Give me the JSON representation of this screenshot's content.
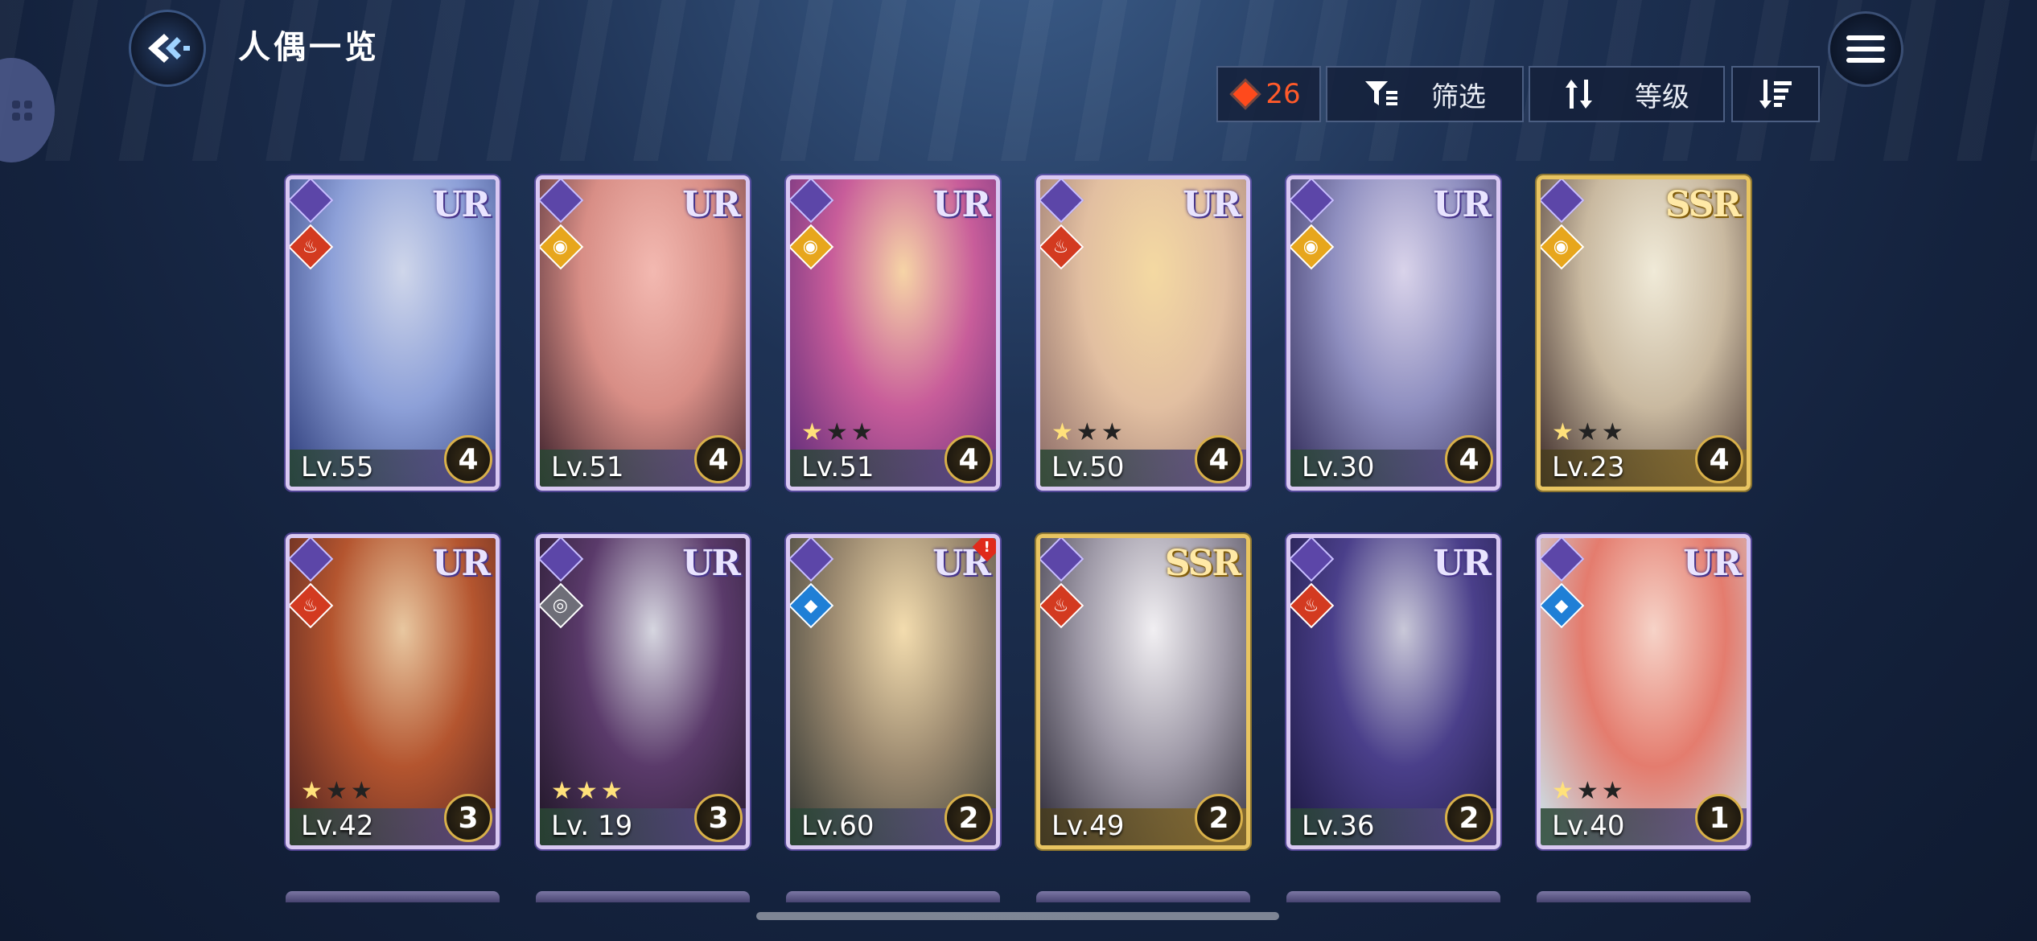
{
  "header": {
    "title": "人偶一览",
    "currency_value": "26",
    "filter_label": "筛选",
    "sort_label": "等级"
  },
  "cards": [
    {
      "rarity": "UR",
      "element": "fire",
      "level": "Lv.55",
      "stars": 0,
      "rank": "4",
      "art": [
        "#cfd6ea",
        "#8da0d8",
        "#2b3a78"
      ]
    },
    {
      "rarity": "UR",
      "element": "light",
      "level": "Lv.51",
      "stars": 0,
      "rank": "4",
      "art": [
        "#f3b9b1",
        "#d88e86",
        "#3a1f2a"
      ]
    },
    {
      "rarity": "UR",
      "element": "light",
      "level": "Lv.51",
      "stars": 1,
      "rank": "4",
      "art": [
        "#f6d4a6",
        "#c85d9a",
        "#5b2a78"
      ]
    },
    {
      "rarity": "UR",
      "element": "fire",
      "level": "Lv.50",
      "stars": 1,
      "rank": "4",
      "art": [
        "#f4d9a2",
        "#e2bfa1",
        "#8a6a66"
      ]
    },
    {
      "rarity": "UR",
      "element": "light",
      "level": "Lv.30",
      "stars": 0,
      "rank": "4",
      "art": [
        "#d9d3ea",
        "#8f8fc0",
        "#2e2855"
      ]
    },
    {
      "rarity": "SSR",
      "element": "light",
      "level": "Lv.23",
      "stars": 1,
      "rank": "4",
      "art": [
        "#f0ead8",
        "#c9b9a0",
        "#3b2a28"
      ]
    },
    {
      "rarity": "UR",
      "element": "fire",
      "level": "Lv.42",
      "stars": 1,
      "rank": "3",
      "art": [
        "#e8c7a0",
        "#b4552f",
        "#4a2020"
      ]
    },
    {
      "rarity": "UR",
      "element": "dark",
      "level": "Lv. 19",
      "stars": 3,
      "rank": "3",
      "art": [
        "#d6d6e0",
        "#5a3a6a",
        "#1f1626"
      ]
    },
    {
      "rarity": "UR",
      "element": "water",
      "level": "Lv.60",
      "stars": 0,
      "rank": "2",
      "art": [
        "#f3dcae",
        "#9c8a70",
        "#2e3330"
      ],
      "notice": "!"
    },
    {
      "rarity": "SSR",
      "element": "fire",
      "level": "Lv.49",
      "stars": 0,
      "rank": "2",
      "art": [
        "#f1eff2",
        "#9f9aa8",
        "#2a2734"
      ]
    },
    {
      "rarity": "UR",
      "element": "fire",
      "level": "Lv.36",
      "stars": 0,
      "rank": "2",
      "art": [
        "#c9c8d8",
        "#4a3f8a",
        "#1b1840"
      ]
    },
    {
      "rarity": "UR",
      "element": "water",
      "level": "Lv.40",
      "stars": 1,
      "rank": "1",
      "art": [
        "#f6d3c8",
        "#e47c6e",
        "#c9e6f0"
      ]
    }
  ],
  "icons": {
    "back": "back-arrow-icon",
    "menu": "hamburger-menu-icon",
    "currency": "red-gem-icon",
    "filter": "filter-icon",
    "sort": "sort-arrows-icon",
    "order": "descending-order-icon"
  },
  "colors": {
    "currency": "#ff5a2a",
    "ur_border": "#d9c8f2",
    "ssr_border": "#e8c461"
  }
}
